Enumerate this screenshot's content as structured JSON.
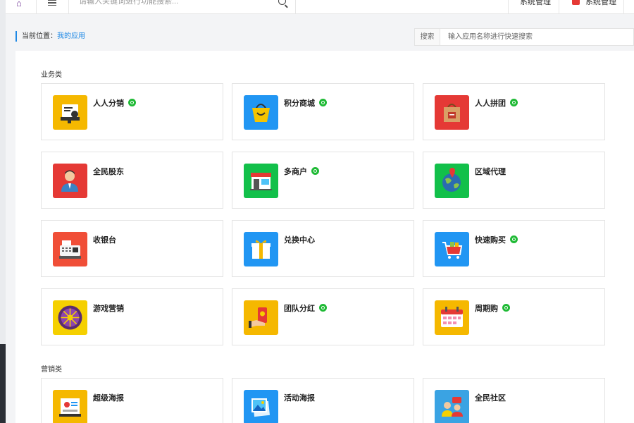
{
  "topbar": {
    "search_placeholder": "请输入关键词进行功能搜索...",
    "system_btn_1": "系统管理",
    "system_btn_2": "系统管理"
  },
  "breadcrumb": {
    "prefix": "当前位置：",
    "current": "我的应用"
  },
  "quick_search": {
    "label": "搜索",
    "placeholder": "输入应用名称进行快速搜索"
  },
  "sections": [
    {
      "title": "业务类",
      "apps": [
        {
          "name": "人人分销",
          "miniprogram": true,
          "icon": "distribution-icon",
          "color": "#f5b800"
        },
        {
          "name": "积分商城",
          "miniprogram": true,
          "icon": "shopping-bag-icon",
          "color": "#2196f3"
        },
        {
          "name": "人人拼团",
          "miniprogram": true,
          "icon": "group-buy-bag-icon",
          "color": "#e53935"
        },
        {
          "name": "全民股东",
          "miniprogram": false,
          "icon": "shareholder-icon",
          "color": "#e53935"
        },
        {
          "name": "多商户",
          "miniprogram": true,
          "icon": "storefront-icon",
          "color": "#12c04a"
        },
        {
          "name": "区域代理",
          "miniprogram": false,
          "icon": "globe-pin-icon",
          "color": "#12c04a"
        },
        {
          "name": "收银台",
          "miniprogram": false,
          "icon": "cash-register-icon",
          "color": "#f04e37"
        },
        {
          "name": "兑换中心",
          "miniprogram": false,
          "icon": "gift-box-icon",
          "color": "#2196f3"
        },
        {
          "name": "快速购买",
          "miniprogram": true,
          "icon": "shopping-cart-icon",
          "color": "#2196f3"
        },
        {
          "name": "游戏营销",
          "miniprogram": false,
          "icon": "prize-wheel-icon",
          "color": "#f5d000"
        },
        {
          "name": "团队分红",
          "miniprogram": true,
          "icon": "red-envelope-icon",
          "color": "#f5b800"
        },
        {
          "name": "周期购",
          "miniprogram": true,
          "icon": "calendar-icon",
          "color": "#f5b800"
        }
      ]
    },
    {
      "title": "营销类",
      "apps": [
        {
          "name": "超级海报",
          "miniprogram": false,
          "icon": "poster-icon",
          "color": "#f5b800"
        },
        {
          "name": "活动海报",
          "miniprogram": false,
          "icon": "photo-poster-icon",
          "color": "#2196f3"
        },
        {
          "name": "全民社区",
          "miniprogram": false,
          "icon": "community-icon",
          "color": "#3aa3e3"
        }
      ]
    }
  ]
}
